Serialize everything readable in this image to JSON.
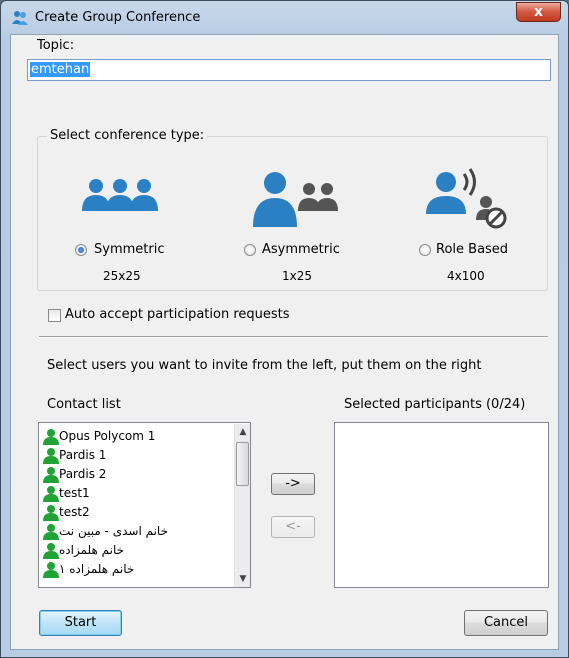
{
  "window": {
    "title": "Create Group Conference",
    "close_label": "x"
  },
  "topic": {
    "label": "Topic:",
    "value": "emtehan"
  },
  "conference_type": {
    "legend": "Select conference type:",
    "options": [
      {
        "label": "Symmetric",
        "size": "25x25",
        "selected": true,
        "icon": "symmetric-users-icon"
      },
      {
        "label": "Asymmetric",
        "size": "1x25",
        "selected": false,
        "icon": "asymmetric-users-icon"
      },
      {
        "label": "Role Based",
        "size": "4x100",
        "selected": false,
        "icon": "role-based-users-icon"
      }
    ]
  },
  "auto_accept": {
    "label": "Auto accept participation requests",
    "checked": false
  },
  "instructions": "Select users you want to invite from the left, put them on the right",
  "contact_list": {
    "label": "Contact list",
    "items": [
      "Opus Polycom 1",
      "Pardis 1",
      "Pardis 2",
      "test1",
      "test2",
      "خانم اسدی - مبین نت",
      "خانم هلمزاده",
      "خانم هلمزاده ۱"
    ]
  },
  "selected": {
    "label": "Selected participants (0/24)",
    "items": []
  },
  "transfer": {
    "add_label": "->",
    "remove_label": "<-"
  },
  "buttons": {
    "start": "Start",
    "cancel": "Cancel"
  },
  "colors": {
    "accent_blue": "#2b7fc3",
    "contact_green": "#21a336",
    "selection": "#3399ff"
  }
}
